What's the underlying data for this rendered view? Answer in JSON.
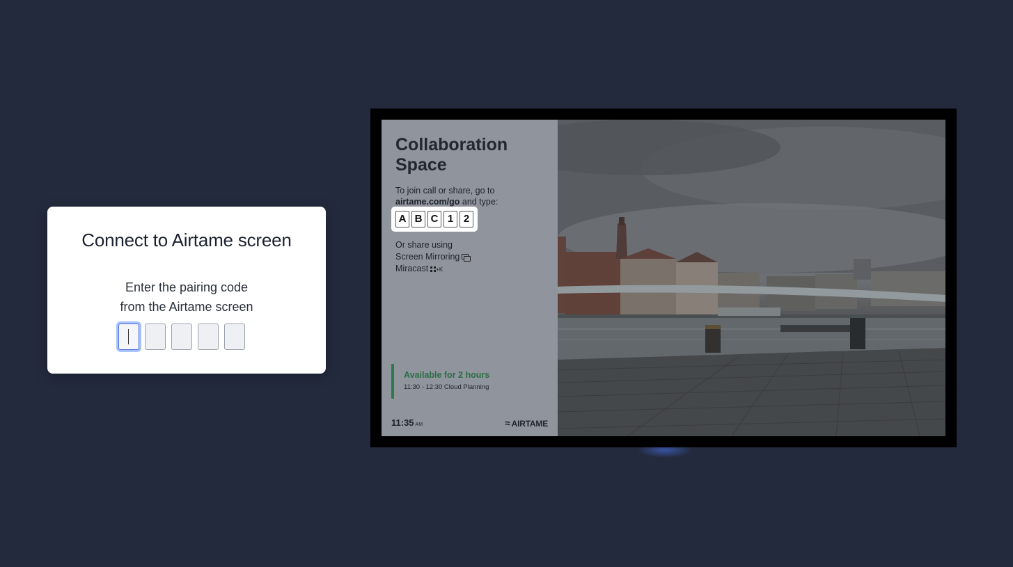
{
  "pairing_card": {
    "title": "Connect to Airtame screen",
    "instruction_line1": "Enter the pairing code",
    "instruction_line2": "from the Airtame screen",
    "code_inputs": [
      "",
      "",
      "",
      "",
      ""
    ]
  },
  "display": {
    "room_title_line1": "Collaboration",
    "room_title_line2": "Space",
    "join_line1": "To join call or share, go to",
    "join_url": "airtame.com/go",
    "join_suffix": " and type:",
    "pairing_code": [
      "A",
      "B",
      "C",
      "1",
      "2"
    ],
    "share_intro": "Or share using",
    "share_option_1": "Screen Mirroring",
    "share_option_2": "Miracast",
    "miracast_shortcut": "+K",
    "availability_title": "Available for 2 hours",
    "next_meeting": "11:30 - 12:30 Cloud Planning",
    "clock_time": "11:35",
    "clock_ampm": "AM",
    "brand_mark": "≈",
    "brand_name": "AIRTAME"
  },
  "colors": {
    "background": "#232a3d",
    "focus_ring": "#a9c3ff",
    "availability_green": "#2f7a4a"
  },
  "icons": [
    "mirror-icon",
    "windows-key-icon",
    "airtame-logo-icon"
  ]
}
